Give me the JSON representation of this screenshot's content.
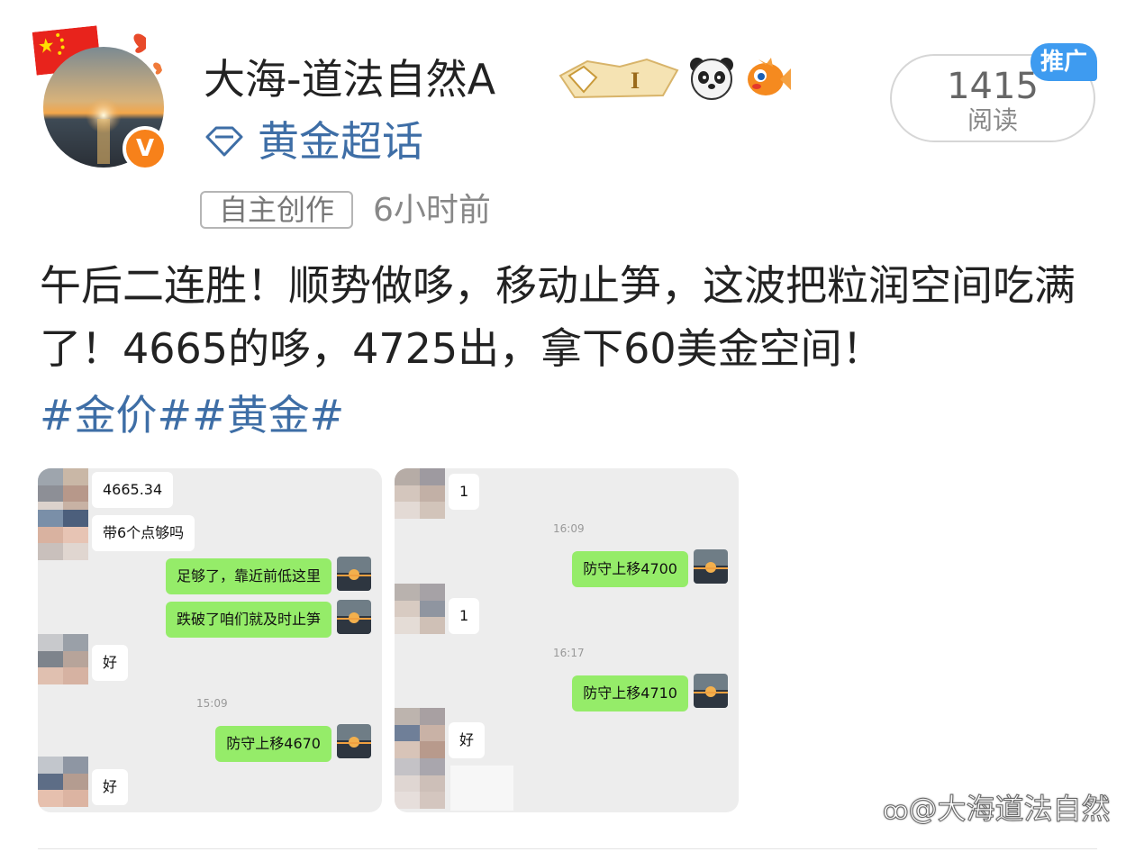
{
  "user": {
    "name": "大海-道法自然A",
    "verified_badge": "V"
  },
  "topic": {
    "label": "黄金超话"
  },
  "post_meta": {
    "tag": "自主创作",
    "time": "6小时前"
  },
  "reads": {
    "count": "1415",
    "label": "阅读",
    "promo": "推广"
  },
  "post": {
    "text": "午后二连胜！顺势做哆，移动止笋，这波把粒润空间吃满了！4665的哆，4725出，拿下60美金空间！",
    "hashtags": "#金价##黄金#"
  },
  "chat1": {
    "m1": "4665.34",
    "m2": "带6个点够吗",
    "m3": "足够了，靠近前低这里",
    "m4": "跌破了咱们就及时止笋",
    "m5": "好",
    "t1": "15:09",
    "m6": "防守上移4670",
    "m7": "好"
  },
  "chat2": {
    "m1": "1",
    "t1": "16:09",
    "m2": "防守上移4700",
    "m3": "1",
    "t2": "16:17",
    "m4": "防守上移4710",
    "m5": "好"
  },
  "watermark": "@大海道法自然",
  "colors": {
    "link_blue": "#3e6ea6",
    "verified_orange": "#f7811a",
    "promo_blue": "#3e9bf0",
    "bubble_green": "#95ec69",
    "chat_bg": "#ededed"
  },
  "icons": [
    "china-flag-icon",
    "verified-v-icon",
    "gold-medal-icon",
    "panda-icon",
    "fish-icon",
    "diamond-topic-icon",
    "watermark-logo-icon"
  ]
}
